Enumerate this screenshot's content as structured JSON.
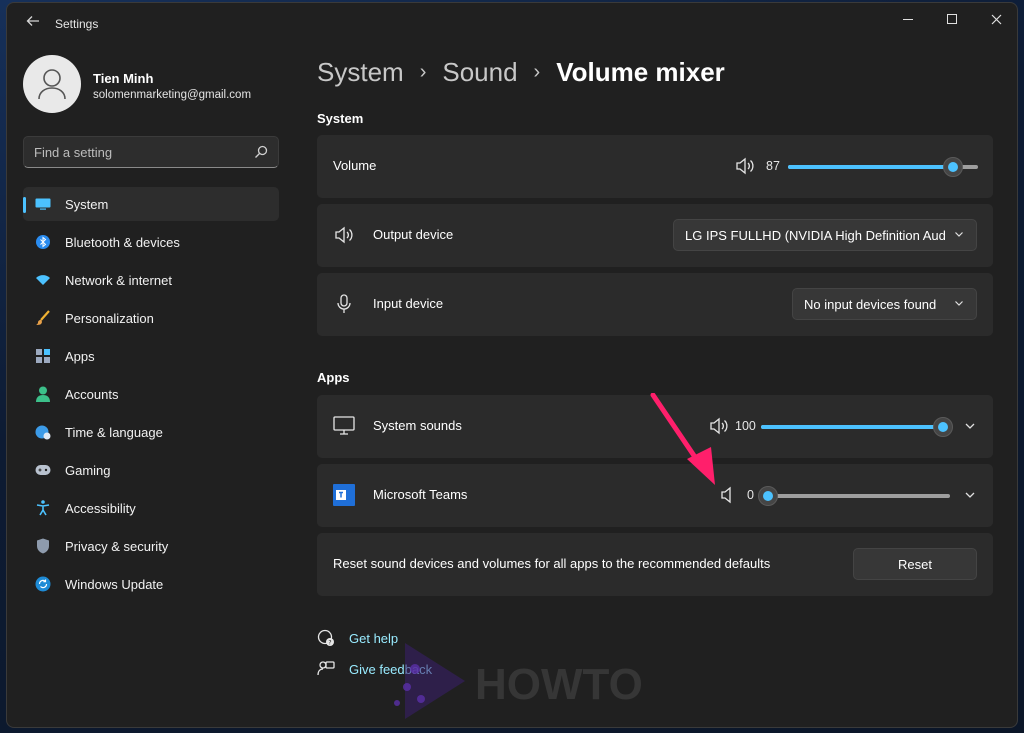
{
  "window": {
    "title": "Settings",
    "back_icon": "back-arrow-icon"
  },
  "profile": {
    "name": "Tien Minh",
    "email": "solomenmarketing@gmail.com"
  },
  "search": {
    "placeholder": "Find a setting",
    "value": ""
  },
  "nav": [
    {
      "label": "System",
      "icon": "system-display-icon",
      "active": true
    },
    {
      "label": "Bluetooth & devices",
      "icon": "bluetooth-icon"
    },
    {
      "label": "Network & internet",
      "icon": "wifi-icon"
    },
    {
      "label": "Personalization",
      "icon": "brush-icon"
    },
    {
      "label": "Apps",
      "icon": "apps-icon"
    },
    {
      "label": "Accounts",
      "icon": "person-icon"
    },
    {
      "label": "Time & language",
      "icon": "globe-clock-icon"
    },
    {
      "label": "Gaming",
      "icon": "gamepad-icon"
    },
    {
      "label": "Accessibility",
      "icon": "accessibility-icon"
    },
    {
      "label": "Privacy & security",
      "icon": "shield-icon"
    },
    {
      "label": "Windows Update",
      "icon": "update-icon"
    }
  ],
  "breadcrumb": {
    "items": [
      "System",
      "Sound"
    ],
    "current": "Volume mixer"
  },
  "system_section": {
    "title": "System",
    "volume": {
      "label": "Volume",
      "value": "87",
      "level": 0.87
    },
    "output": {
      "label": "Output device",
      "selected": "LG IPS FULLHD (NVIDIA High Definition Aud"
    },
    "input": {
      "label": "Input device",
      "selected": "No input devices found"
    }
  },
  "apps_section": {
    "title": "Apps",
    "items": [
      {
        "label": "System sounds",
        "value": "100",
        "level": 1.0,
        "icon": "monitor-icon"
      },
      {
        "label": "Microsoft Teams",
        "value": "0",
        "level": 0.0,
        "icon": "teams-icon"
      }
    ],
    "reset": {
      "label": "Reset sound devices and volumes for all apps to the recommended defaults",
      "button": "Reset"
    }
  },
  "links": {
    "help": "Get help",
    "feedback": "Give feedback"
  },
  "watermark": "HOWTO",
  "colors": {
    "accent": "#4cc2ff",
    "arrow": "#ff1f6b",
    "window_bg": "#202020",
    "card_bg": "#2b2b2b",
    "link": "#99ebff"
  }
}
